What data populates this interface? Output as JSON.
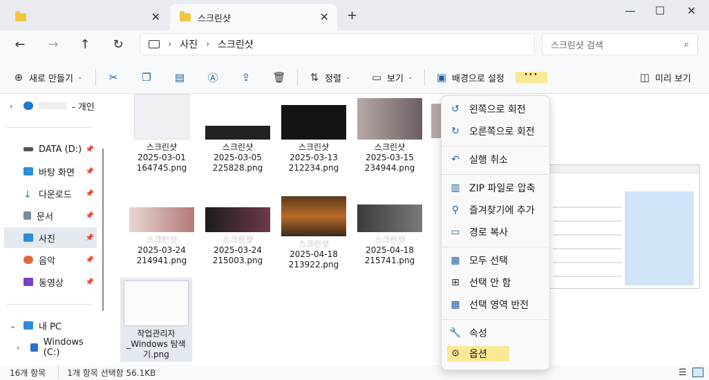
{
  "tabs": [
    {
      "label": ""
    },
    {
      "label": "스크린샷"
    }
  ],
  "nav": {
    "newtab": "+",
    "back": "←",
    "forward": "→",
    "up": "↑",
    "refresh": "↻"
  },
  "window": {
    "minimize": "—",
    "maximize": "☐",
    "close": "✕"
  },
  "address": {
    "crumbs": [
      "사진",
      "스크린샷"
    ],
    "sep": "›"
  },
  "search": {
    "placeholder": "스크린샷 검색"
  },
  "toolbar": {
    "new_label": "새로 만들기",
    "sort_label": "정렬",
    "view_label": "보기",
    "background_label": "배경으로 설정",
    "more": "···",
    "preview_label": "미리 보기"
  },
  "sidebar": {
    "personal": "- 개인",
    "items": [
      {
        "label": "DATA (D:)"
      },
      {
        "label": "바탕 화면"
      },
      {
        "label": "다운로드"
      },
      {
        "label": "문서"
      },
      {
        "label": "사진"
      },
      {
        "label": "음악"
      },
      {
        "label": "동영상"
      }
    ],
    "thispc": "내 PC",
    "drive": "Windows (C:)"
  },
  "files": [
    {
      "line1": "스크린샷",
      "line2": "2025-03-01",
      "line3": "164745.png"
    },
    {
      "line1": "스크린샷",
      "line2": "2025-03-05",
      "line3": "225828.png"
    },
    {
      "line1": "스크린샷",
      "line2": "2025-03-13",
      "line3": "212234.png"
    },
    {
      "line1": "스크린샷",
      "line2": "2025-03-15",
      "line3": "234944.png"
    },
    {
      "line1": "스크린샷",
      "line2": "2025-03-24",
      "line3": "214941.png"
    },
    {
      "line1": "스크린샷",
      "line2": "2025-03-24",
      "line3": "215003.png"
    },
    {
      "line1": "스크린샷",
      "line2": "2025-04-18",
      "line3": "213922.png"
    },
    {
      "line1": "스크린샷",
      "line2": "2025-04-18",
      "line3": "215741.png"
    },
    {
      "line1": "작업관리자",
      "line2": "_Windows 탐색",
      "line3": "기.png"
    }
  ],
  "menu": {
    "items": [
      "왼쪽으로 회전",
      "오른쪽으로 회전",
      "실행 취소",
      "ZIP 파일로 압축",
      "즐겨찾기에 추가",
      "경로 복사",
      "모두 선택",
      "선택 안 함",
      "선택 영역 반전",
      "속성",
      "옵션"
    ]
  },
  "status": {
    "count": "16개 항목",
    "selected": "1개 항목 선택함 56.1KB"
  },
  "colors": {
    "accent": "#1e5fa0",
    "highlight": "#fbe893",
    "folder": "#f3c53d"
  }
}
